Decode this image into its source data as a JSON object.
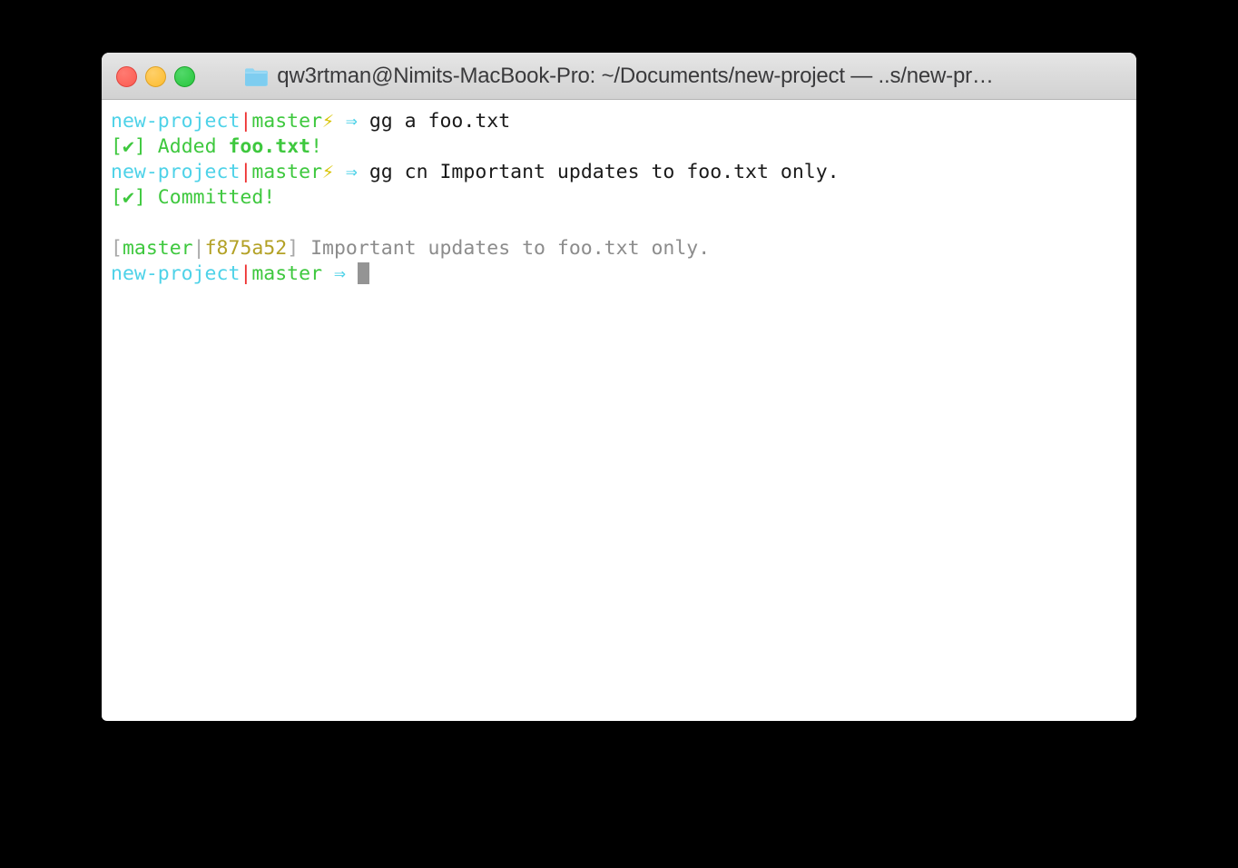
{
  "window": {
    "title": "qw3rtman@Nimits-MacBook-Pro: ~/Documents/new-project — ..s/new-pr…",
    "folder_icon": "folder-icon",
    "controls": {
      "close_label": "",
      "minimize_label": "",
      "maximize_label": ""
    },
    "colors": {
      "close": "#fb5a50",
      "minimize": "#fcbb2d",
      "maximize": "#27c53c",
      "titlebar": "#dcdcdc",
      "background": "#ffffff",
      "desktop": "#000000"
    }
  },
  "terminal": {
    "colors": {
      "directory": "#4ed2e8",
      "separator": "#ee2f2f",
      "branch": "#3ec83e",
      "dirty_marker": "#d9c406",
      "arrow": "#4ed2e8",
      "command": "#1a1a1a",
      "success": "#3ec83e",
      "bracket_gray": "#a8a8a8",
      "commit_hash": "#b3a125",
      "commit_message": "#8c8c8c",
      "cursor": "#949494"
    },
    "lines": [
      {
        "type": "prompt-command",
        "dir": "new-project",
        "sep": "|",
        "branch": "master",
        "dirty": "⚡",
        "arrow": "⇒",
        "command": "gg a foo.txt"
      },
      {
        "type": "success",
        "bracket_open": "[",
        "check": "✔",
        "bracket_close": "]",
        "text": " Added ",
        "bold": "foo.txt",
        "suffix": "!"
      },
      {
        "type": "prompt-command",
        "dir": "new-project",
        "sep": "|",
        "branch": "master",
        "dirty": "⚡",
        "arrow": "⇒",
        "command": "gg cn Important updates to foo.txt only."
      },
      {
        "type": "success",
        "bracket_open": "[",
        "check": "✔",
        "bracket_close": "]",
        "text": " Committed!",
        "bold": "",
        "suffix": ""
      },
      {
        "type": "blank",
        "text": " "
      },
      {
        "type": "commit",
        "bracket_open": "[",
        "branch": "master",
        "sep": "|",
        "hash": "f875a52",
        "bracket_close": "]",
        "message": " Important updates to foo.txt only."
      },
      {
        "type": "prompt-cursor",
        "dir": "new-project",
        "sep": "|",
        "branch": "master",
        "arrow": " ⇒ "
      }
    ]
  }
}
